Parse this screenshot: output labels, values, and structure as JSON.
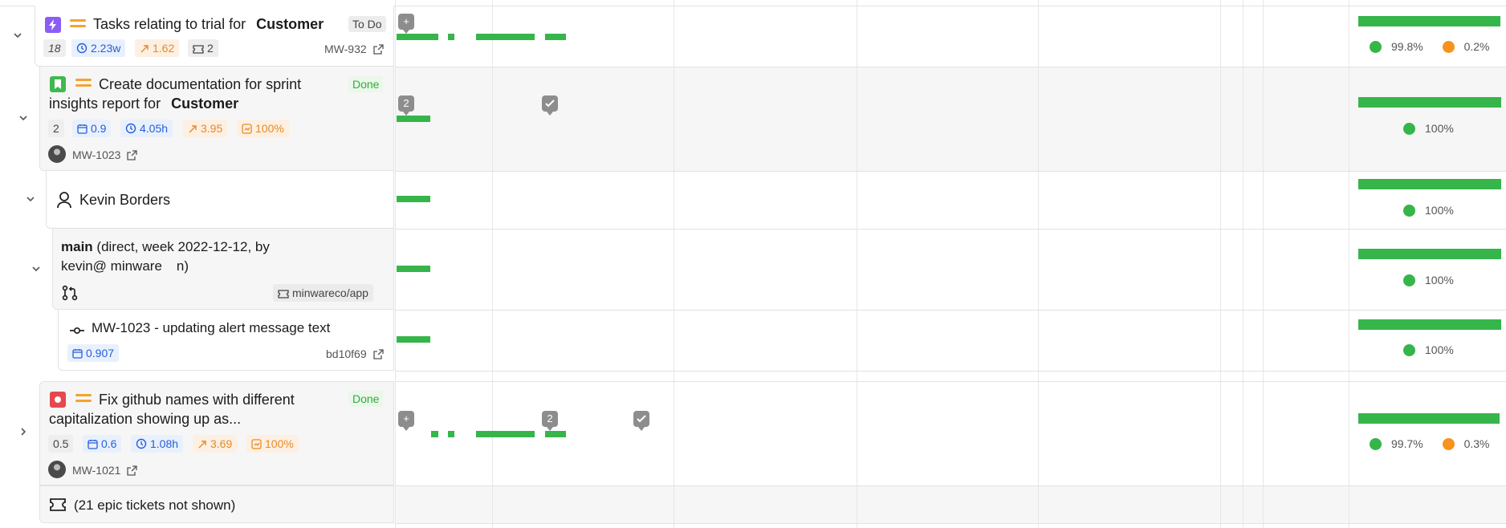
{
  "colors": {
    "green": "#36b54a",
    "orange": "#f7931e",
    "done": "#2eae3a",
    "blue": "#2560d8"
  },
  "rows": {
    "task1": {
      "title": "Tasks relating to trial for",
      "customer": "Customer",
      "status": "To Do",
      "issue_icon": "lightning-icon",
      "chips": {
        "count": "18",
        "time": "2.23w",
        "trend": "1.62",
        "tickets": "2"
      },
      "key": "MW-932",
      "legend": {
        "green": "99.8%",
        "orange": "0.2%"
      },
      "progress_fraction": 0.98
    },
    "task2": {
      "title_line1": "Create documentation for sprint",
      "title_line2": "insights report for",
      "customer": "Customer",
      "status": "Done",
      "issue_icon": "bookmark-icon",
      "chips": {
        "count": "2",
        "calendar": "0.9",
        "time": "4.05h",
        "trend": "3.95",
        "percent": "100%"
      },
      "key": "MW-1023",
      "badges": {
        "count": "2"
      },
      "legend": {
        "green": "100%"
      },
      "progress_fraction": 1.0
    },
    "person": {
      "name": "Kevin Borders",
      "legend": {
        "green": "100%"
      },
      "progress_fraction": 1.0
    },
    "branch": {
      "name": "main",
      "line1_rest": " (direct, week 2022-12-12, by",
      "line2": "kevin@ minware",
      "line2_end": "n)",
      "repo": "minwareco/app",
      "legend": {
        "green": "100%"
      },
      "progress_fraction": 1.0
    },
    "commit": {
      "title": "MW-1023 - updating alert message text",
      "calendar": "0.907",
      "hash": "bd10f69",
      "legend": {
        "green": "100%"
      },
      "progress_fraction": 1.0
    },
    "task3": {
      "title_line1": "Fix github names with different",
      "title_line2": "capitalization showing up as...",
      "status": "Done",
      "issue_icon": "bug-icon",
      "chips": {
        "count": "0.5",
        "calendar": "0.6",
        "time": "1.08h",
        "trend": "3.69",
        "percent": "100%"
      },
      "key": "MW-1021",
      "badges": {
        "count": "2"
      },
      "legend": {
        "green": "99.7%",
        "orange": "0.3%"
      },
      "progress_fraction": 0.98
    },
    "hidden": {
      "text": "(21 epic tickets not shown)"
    }
  }
}
